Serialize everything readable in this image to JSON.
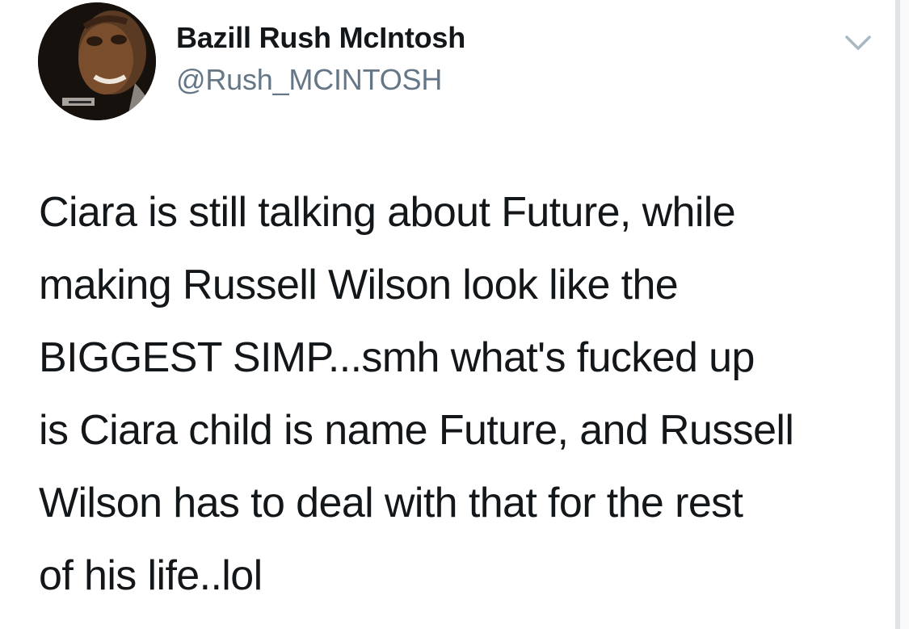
{
  "author": {
    "display_name": "Bazill Rush McIntosh",
    "handle": "@Rush_MCINTOSH",
    "avatar_icon": "profile-avatar"
  },
  "menu": {
    "caret_icon": "chevron-down-icon"
  },
  "tweet": {
    "lines": [
      "Ciara is still talking about Future, while",
      "making Russell Wilson look like the",
      "BIGGEST SIMP...smh what's fucked up",
      "is Ciara child is name Future, and Russell",
      "Wilson has to deal with that for the rest",
      "of his life..lol"
    ]
  },
  "colors": {
    "text_primary": "#14171a",
    "text_secondary": "#657786",
    "icon_gray": "#aab8c2",
    "divider": "#e1e4e6"
  }
}
